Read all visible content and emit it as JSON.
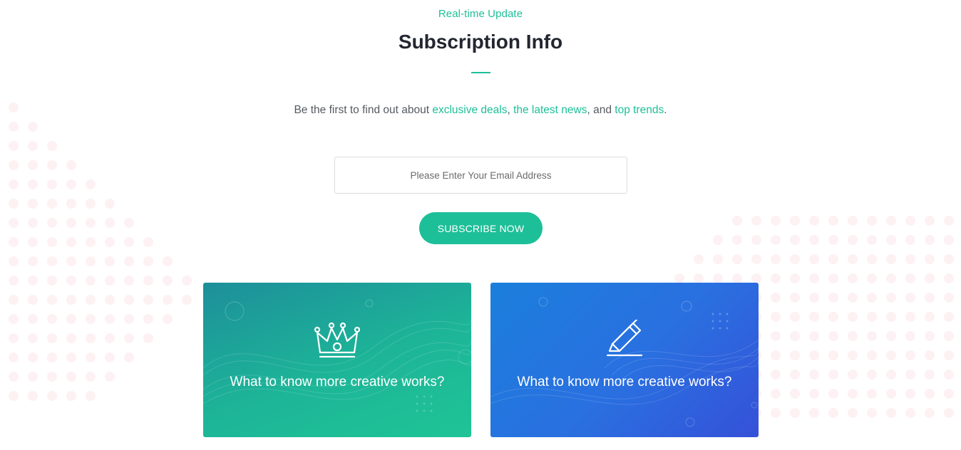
{
  "eyebrow": "Real-time Update",
  "title": "Subscription Info",
  "lead": {
    "prefix": "Be the first to find out about ",
    "link1": "exclusive deals",
    "sep1": ", ",
    "link2": "the latest news",
    "sep2": ", and ",
    "link3": "top trends",
    "suffix": "."
  },
  "form": {
    "email_placeholder": "Please Enter Your Email Address",
    "email_value": "",
    "subscribe_label": "SUBSCRIBE NOW"
  },
  "cards": [
    {
      "icon": "crown-icon",
      "text": "What to know more creative works?"
    },
    {
      "icon": "pencil-icon",
      "text": "What to know more creative works?"
    }
  ],
  "colors": {
    "accent": "#1dbf98",
    "heading": "#222630",
    "body_text": "#555a61",
    "card_green": "#1db598",
    "card_blue": "#2a6fe0",
    "dot_pattern": "#fdf1f3"
  }
}
